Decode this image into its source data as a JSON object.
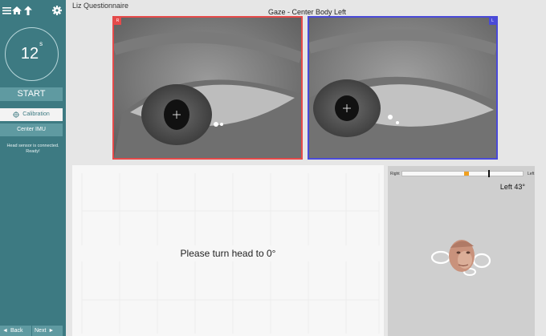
{
  "app": {
    "title": "Liz Questionnaire",
    "subtitle": "Gaze - Center Body Left"
  },
  "sidebar": {
    "icons": [
      "menu-icon",
      "home-icon",
      "upload-arrow-icon",
      "gear-icon"
    ],
    "timer": {
      "value": "12",
      "unit": "s"
    },
    "start_label": "START",
    "calibration_label": "Calibration",
    "center_imu_label": "Center IMU",
    "status_line1": "Head sensor is connected.",
    "status_line2": "Ready!",
    "back_label": "Back",
    "next_label": "Next"
  },
  "eyes": {
    "right_tag": "R",
    "left_tag": "L",
    "colors": {
      "right_border": "#e54a4a",
      "left_border": "#4a4ad8"
    }
  },
  "graphs": {
    "message": "Please turn head to 0°"
  },
  "head": {
    "gauge_right_label": "Right",
    "gauge_left_label": "Left",
    "angle_text": "Left 43°",
    "gauge_position": 0.71,
    "orange_position": 0.51
  },
  "colors": {
    "sidebar": "#3d7a82",
    "button": "#5f9aa1",
    "accent": "#f0a020"
  }
}
